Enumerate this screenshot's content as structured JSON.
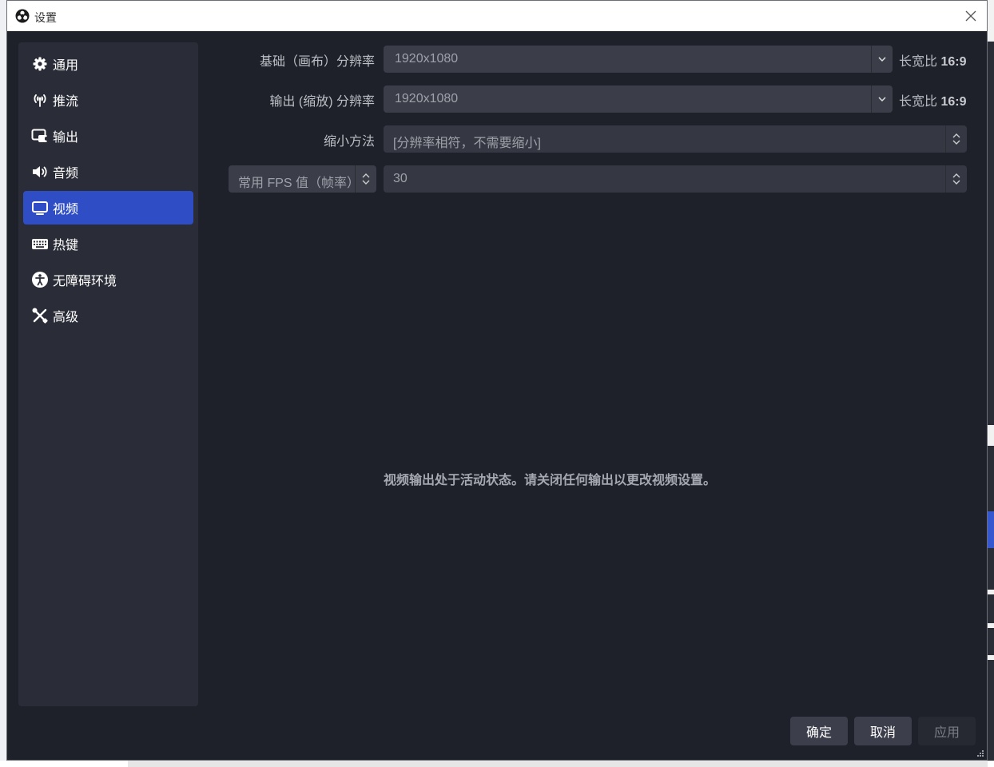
{
  "window": {
    "title": "设置"
  },
  "sidebar": {
    "items": [
      {
        "label": "通用",
        "icon": "gear-icon"
      },
      {
        "label": "推流",
        "icon": "antenna-icon"
      },
      {
        "label": "输出",
        "icon": "output-icon"
      },
      {
        "label": "音频",
        "icon": "speaker-icon"
      },
      {
        "label": "视频",
        "icon": "monitor-icon",
        "active": true
      },
      {
        "label": "热键",
        "icon": "keyboard-icon"
      },
      {
        "label": "无障碍环境",
        "icon": "accessibility-icon"
      },
      {
        "label": "高级",
        "icon": "tools-icon"
      }
    ]
  },
  "video": {
    "base_resolution": {
      "label": "基础（画布）分辨率",
      "value": "1920x1080",
      "aspect_label": "长宽比",
      "aspect_value": "16:9"
    },
    "output_resolution": {
      "label": "输出 (缩放) 分辨率",
      "value": "1920x1080",
      "aspect_label": "长宽比",
      "aspect_value": "16:9"
    },
    "downscale_filter": {
      "label": "缩小方法",
      "value": "[分辨率相符，不需要缩小]"
    },
    "fps": {
      "type_label": "常用 FPS 值（帧率）",
      "value": "30"
    },
    "notice": "视频输出处于活动状态。请关闭任何输出以更改视频设置。"
  },
  "buttons": {
    "ok": "确定",
    "cancel": "取消",
    "apply": "应用"
  },
  "colors": {
    "accent": "#2f4ec5",
    "background": "#1f212a",
    "sidebar": "#2a2d38"
  }
}
